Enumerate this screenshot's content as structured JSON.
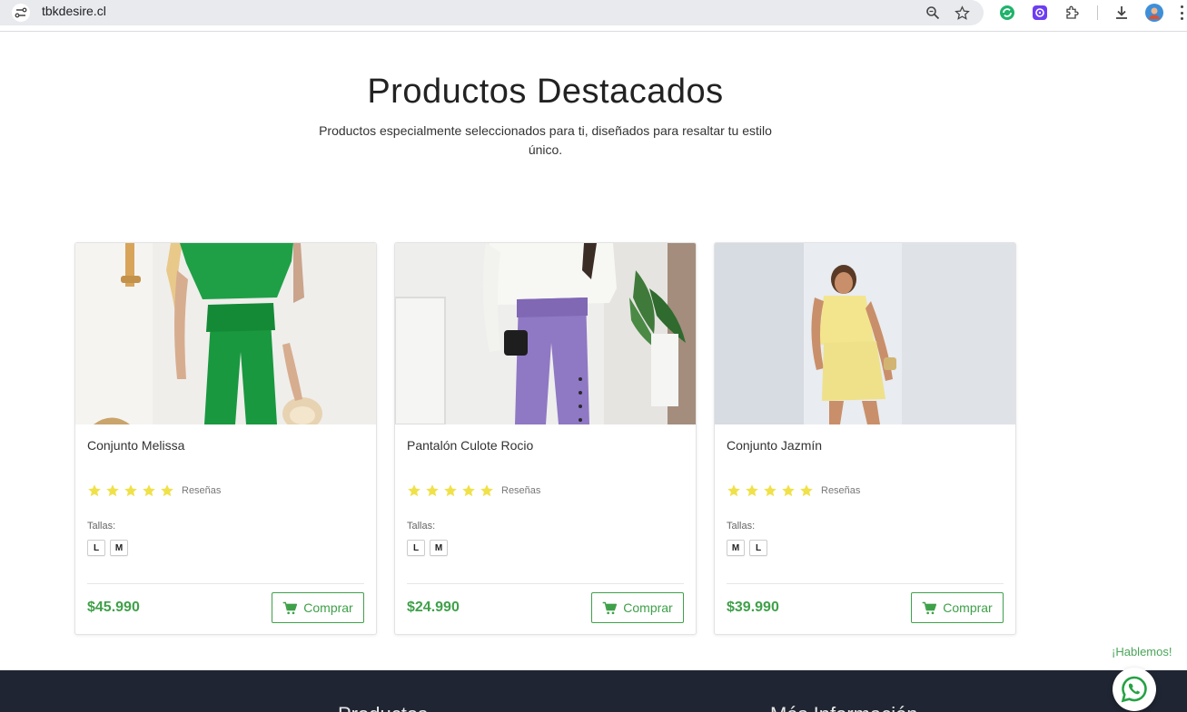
{
  "browser": {
    "url": "tbkdesire.cl",
    "icons": [
      "site-settings-icon",
      "zoom-icon",
      "bookmark-star-icon",
      "extension-green-icon",
      "extension-purple-icon",
      "extensions-puzzle-icon",
      "download-icon",
      "profile-avatar-icon"
    ]
  },
  "section": {
    "title": "Productos Destacados",
    "subtitle": "Productos especialmente seleccionados para ti, diseñados para resaltar tu estilo único."
  },
  "products": [
    {
      "name": "Conjunto Melissa",
      "rating": 5,
      "reviews_label": "Reseñas",
      "sizes_label": "Tallas:",
      "sizes": [
        "L",
        "M"
      ],
      "price": "$45.990",
      "buy_label": "Comprar"
    },
    {
      "name": "Pantalón Culote Rocio",
      "rating": 5,
      "reviews_label": "Reseñas",
      "sizes_label": "Tallas:",
      "sizes": [
        "L",
        "M"
      ],
      "price": "$24.990",
      "buy_label": "Comprar"
    },
    {
      "name": "Conjunto Jazmín",
      "rating": 5,
      "reviews_label": "Reseñas",
      "sizes_label": "Tallas:",
      "sizes": [
        "M",
        "L"
      ],
      "price": "$39.990",
      "buy_label": "Comprar"
    }
  ],
  "footer": {
    "col1_heading": "Productos",
    "col2_heading": "Más Información"
  },
  "chat": {
    "label": "¡Hablemos!"
  },
  "colors": {
    "accent_green": "#3fa04a",
    "star_yellow": "#f0e14a",
    "footer_bg": "#1f2532"
  }
}
